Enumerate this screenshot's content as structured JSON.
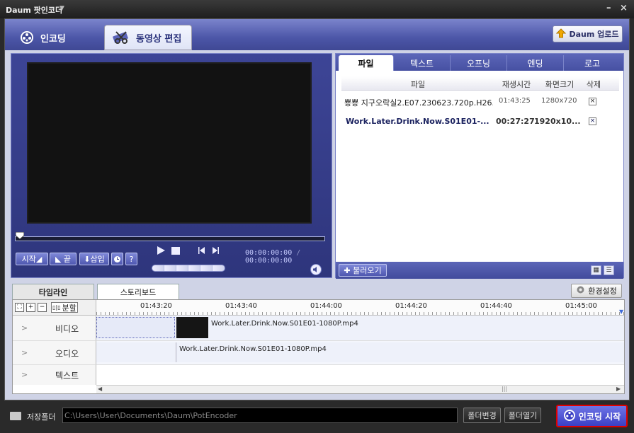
{
  "window": {
    "title": "Daum 팟인코더",
    "dropdown": "▼",
    "minimize": "–",
    "close": "×"
  },
  "tabs": {
    "encode": "인코딩",
    "edit": "동영상 편집"
  },
  "upload_button": "Daum 업로드",
  "player": {
    "btn_start": "시작◢",
    "btn_end": "◣ 끝",
    "btn_insert": "⬇삽입",
    "btn_help": "?",
    "time_current": "00:00:00:00",
    "time_separator": "/",
    "time_total": "00:00:00:00"
  },
  "file_panel": {
    "tabs": [
      "파일",
      "텍스트",
      "오프닝",
      "엔딩",
      "로고"
    ],
    "headers": [
      "파일",
      "재생시간",
      "화면크기",
      "삭제"
    ],
    "rows": [
      {
        "name": "뿅뿅 지구오락실2.E07.230623.720p.H26..",
        "duration": "01:43:25",
        "size": "1280x720",
        "delete": "×",
        "bold": false
      },
      {
        "name": "Work.Later.Drink.Now.S01E01-...",
        "duration": "00:27:27",
        "size": "1920x10...",
        "delete": "×",
        "bold": true
      }
    ],
    "load_button": "✚ 불러오기"
  },
  "timeline_tabs": {
    "timeline": "타임라인",
    "storyboard": "스토리보드"
  },
  "settings_button": "환경설정",
  "timeline": {
    "split_label": "분할",
    "ruler": [
      "01:43:20",
      "01:43:40",
      "01:44:00",
      "01:44:20",
      "01:44:40",
      "01:45:00"
    ],
    "tracks": [
      "비디오",
      "오디오",
      "텍스트"
    ],
    "video_clip": "Work.Later.Drink.Now.S01E01-1080P.mp4",
    "audio_clip": "Work.Later.Drink.Now.S01E01-1080P.mp4",
    "scroll_grip": "|||"
  },
  "footer": {
    "folder_label": "저장폴더",
    "path": "C:\\Users\\User\\Documents\\Daum\\PotEncoder",
    "change_folder": "폴더변경",
    "open_folder": "폴더열기",
    "start_encoding": "인코딩 시작"
  },
  "colors": {
    "accent": "#4c56a8",
    "start_border": "#e00000"
  }
}
